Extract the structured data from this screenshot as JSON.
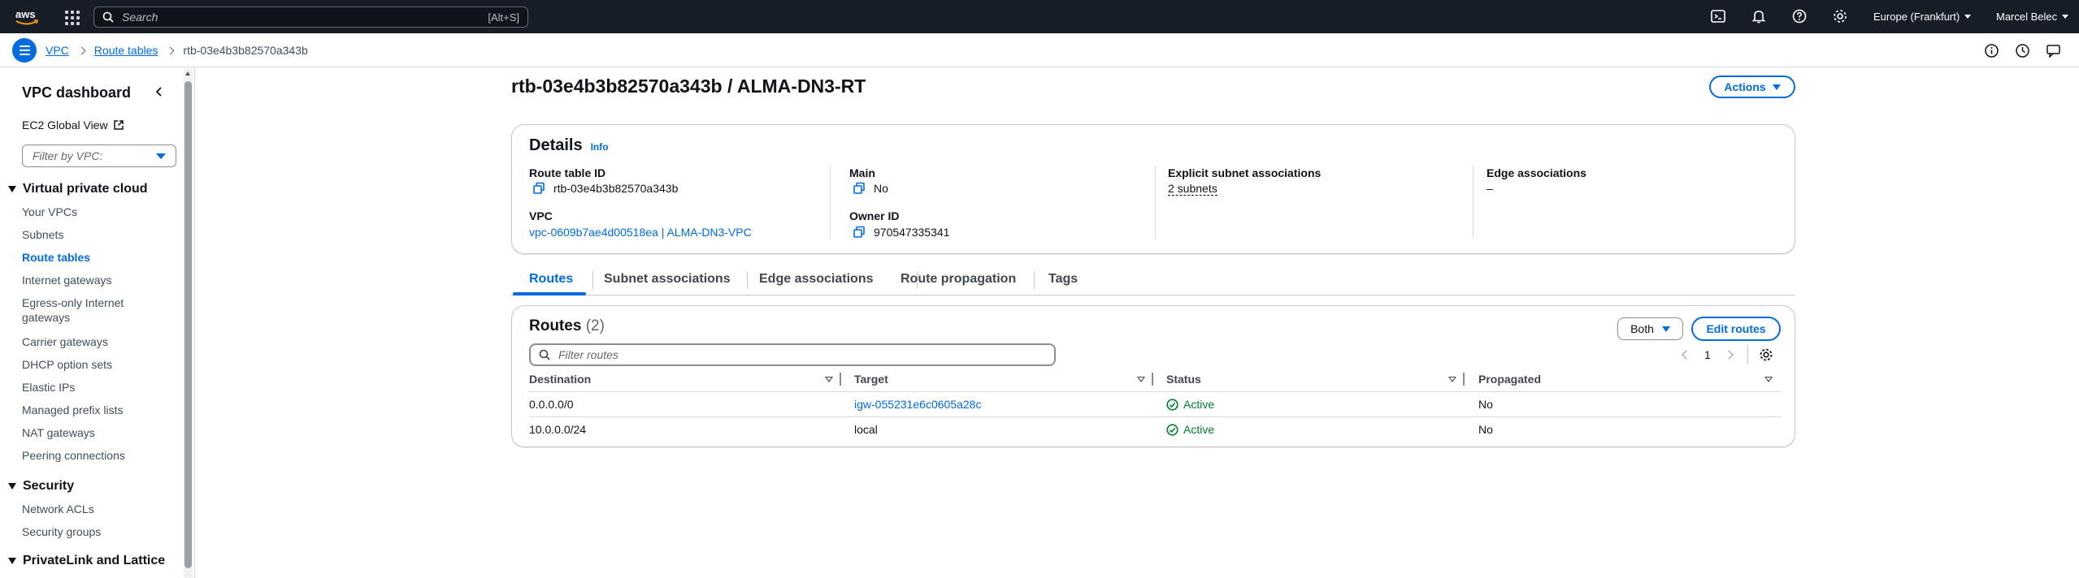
{
  "topnav": {
    "search_placeholder": "Search",
    "search_shortcut": "[Alt+S]",
    "region": "Europe (Frankfurt)",
    "user": "Marcel Belec"
  },
  "breadcrumb": {
    "items": [
      "VPC",
      "Route tables"
    ],
    "current": "rtb-03e4b3b82570a343b"
  },
  "sidebar": {
    "title": "VPC dashboard",
    "global_view": "EC2 Global View",
    "filter_placeholder": "Filter by VPC:",
    "sections": [
      {
        "title": "Virtual private cloud",
        "items": [
          "Your VPCs",
          "Subnets",
          "Route tables",
          "Internet gateways",
          "Egress-only Internet gateways",
          "Carrier gateways",
          "DHCP option sets",
          "Elastic IPs",
          "Managed prefix lists",
          "NAT gateways",
          "Peering connections"
        ]
      },
      {
        "title": "Security",
        "items": [
          "Network ACLs",
          "Security groups"
        ]
      },
      {
        "title": "PrivateLink and Lattice",
        "items": []
      }
    ]
  },
  "page": {
    "title": "rtb-03e4b3b82570a343b / ALMA-DN3-RT",
    "actions_label": "Actions"
  },
  "details": {
    "title": "Details",
    "info": "Info",
    "route_table_id_label": "Route table ID",
    "route_table_id": "rtb-03e4b3b82570a343b",
    "main_label": "Main",
    "main": "No",
    "explicit_label": "Explicit subnet associations",
    "explicit": "2 subnets",
    "edge_label": "Edge associations",
    "edge": "–",
    "vpc_label": "VPC",
    "vpc": "vpc-0609b7ae4d00518ea | ALMA-DN3-VPC",
    "owner_label": "Owner ID",
    "owner": "970547335341"
  },
  "tabs": [
    "Routes",
    "Subnet associations",
    "Edge associations",
    "Route propagation",
    "Tags"
  ],
  "routes": {
    "title": "Routes",
    "count": "(2)",
    "both_label": "Both",
    "edit_label": "Edit routes",
    "filter_placeholder": "Filter routes",
    "page": "1",
    "columns": [
      "Destination",
      "Target",
      "Status",
      "Propagated"
    ],
    "rows": [
      {
        "destination": "0.0.0.0/0",
        "target": "igw-055231e6c0605a28c",
        "status": "Active",
        "propagated": "No"
      },
      {
        "destination": "10.0.0.0/24",
        "target": "local",
        "status": "Active",
        "propagated": "No"
      }
    ]
  },
  "colors": {
    "accent": "#006ce0",
    "topbar": "#161d26",
    "success": "#00802f"
  }
}
